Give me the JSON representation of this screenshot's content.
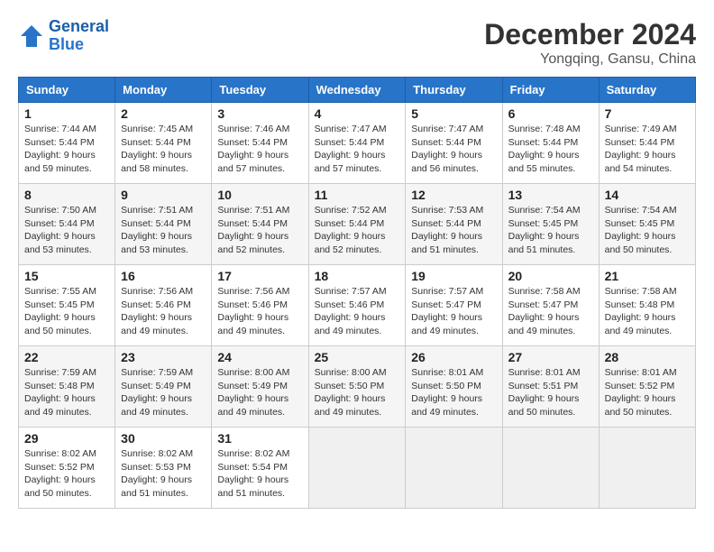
{
  "logo": {
    "line1": "General",
    "line2": "Blue"
  },
  "title": "December 2024",
  "location": "Yongqing, Gansu, China",
  "weekdays": [
    "Sunday",
    "Monday",
    "Tuesday",
    "Wednesday",
    "Thursday",
    "Friday",
    "Saturday"
  ],
  "weeks": [
    [
      {
        "day": "1",
        "sunrise": "7:44 AM",
        "sunset": "5:44 PM",
        "daylight": "9 hours and 59 minutes."
      },
      {
        "day": "2",
        "sunrise": "7:45 AM",
        "sunset": "5:44 PM",
        "daylight": "9 hours and 58 minutes."
      },
      {
        "day": "3",
        "sunrise": "7:46 AM",
        "sunset": "5:44 PM",
        "daylight": "9 hours and 57 minutes."
      },
      {
        "day": "4",
        "sunrise": "7:47 AM",
        "sunset": "5:44 PM",
        "daylight": "9 hours and 57 minutes."
      },
      {
        "day": "5",
        "sunrise": "7:47 AM",
        "sunset": "5:44 PM",
        "daylight": "9 hours and 56 minutes."
      },
      {
        "day": "6",
        "sunrise": "7:48 AM",
        "sunset": "5:44 PM",
        "daylight": "9 hours and 55 minutes."
      },
      {
        "day": "7",
        "sunrise": "7:49 AM",
        "sunset": "5:44 PM",
        "daylight": "9 hours and 54 minutes."
      }
    ],
    [
      {
        "day": "8",
        "sunrise": "7:50 AM",
        "sunset": "5:44 PM",
        "daylight": "9 hours and 53 minutes."
      },
      {
        "day": "9",
        "sunrise": "7:51 AM",
        "sunset": "5:44 PM",
        "daylight": "9 hours and 53 minutes."
      },
      {
        "day": "10",
        "sunrise": "7:51 AM",
        "sunset": "5:44 PM",
        "daylight": "9 hours and 52 minutes."
      },
      {
        "day": "11",
        "sunrise": "7:52 AM",
        "sunset": "5:44 PM",
        "daylight": "9 hours and 52 minutes."
      },
      {
        "day": "12",
        "sunrise": "7:53 AM",
        "sunset": "5:44 PM",
        "daylight": "9 hours and 51 minutes."
      },
      {
        "day": "13",
        "sunrise": "7:54 AM",
        "sunset": "5:45 PM",
        "daylight": "9 hours and 51 minutes."
      },
      {
        "day": "14",
        "sunrise": "7:54 AM",
        "sunset": "5:45 PM",
        "daylight": "9 hours and 50 minutes."
      }
    ],
    [
      {
        "day": "15",
        "sunrise": "7:55 AM",
        "sunset": "5:45 PM",
        "daylight": "9 hours and 50 minutes."
      },
      {
        "day": "16",
        "sunrise": "7:56 AM",
        "sunset": "5:46 PM",
        "daylight": "9 hours and 49 minutes."
      },
      {
        "day": "17",
        "sunrise": "7:56 AM",
        "sunset": "5:46 PM",
        "daylight": "9 hours and 49 minutes."
      },
      {
        "day": "18",
        "sunrise": "7:57 AM",
        "sunset": "5:46 PM",
        "daylight": "9 hours and 49 minutes."
      },
      {
        "day": "19",
        "sunrise": "7:57 AM",
        "sunset": "5:47 PM",
        "daylight": "9 hours and 49 minutes."
      },
      {
        "day": "20",
        "sunrise": "7:58 AM",
        "sunset": "5:47 PM",
        "daylight": "9 hours and 49 minutes."
      },
      {
        "day": "21",
        "sunrise": "7:58 AM",
        "sunset": "5:48 PM",
        "daylight": "9 hours and 49 minutes."
      }
    ],
    [
      {
        "day": "22",
        "sunrise": "7:59 AM",
        "sunset": "5:48 PM",
        "daylight": "9 hours and 49 minutes."
      },
      {
        "day": "23",
        "sunrise": "7:59 AM",
        "sunset": "5:49 PM",
        "daylight": "9 hours and 49 minutes."
      },
      {
        "day": "24",
        "sunrise": "8:00 AM",
        "sunset": "5:49 PM",
        "daylight": "9 hours and 49 minutes."
      },
      {
        "day": "25",
        "sunrise": "8:00 AM",
        "sunset": "5:50 PM",
        "daylight": "9 hours and 49 minutes."
      },
      {
        "day": "26",
        "sunrise": "8:01 AM",
        "sunset": "5:50 PM",
        "daylight": "9 hours and 49 minutes."
      },
      {
        "day": "27",
        "sunrise": "8:01 AM",
        "sunset": "5:51 PM",
        "daylight": "9 hours and 50 minutes."
      },
      {
        "day": "28",
        "sunrise": "8:01 AM",
        "sunset": "5:52 PM",
        "daylight": "9 hours and 50 minutes."
      }
    ],
    [
      {
        "day": "29",
        "sunrise": "8:02 AM",
        "sunset": "5:52 PM",
        "daylight": "9 hours and 50 minutes."
      },
      {
        "day": "30",
        "sunrise": "8:02 AM",
        "sunset": "5:53 PM",
        "daylight": "9 hours and 51 minutes."
      },
      {
        "day": "31",
        "sunrise": "8:02 AM",
        "sunset": "5:54 PM",
        "daylight": "9 hours and 51 minutes."
      },
      null,
      null,
      null,
      null
    ]
  ]
}
